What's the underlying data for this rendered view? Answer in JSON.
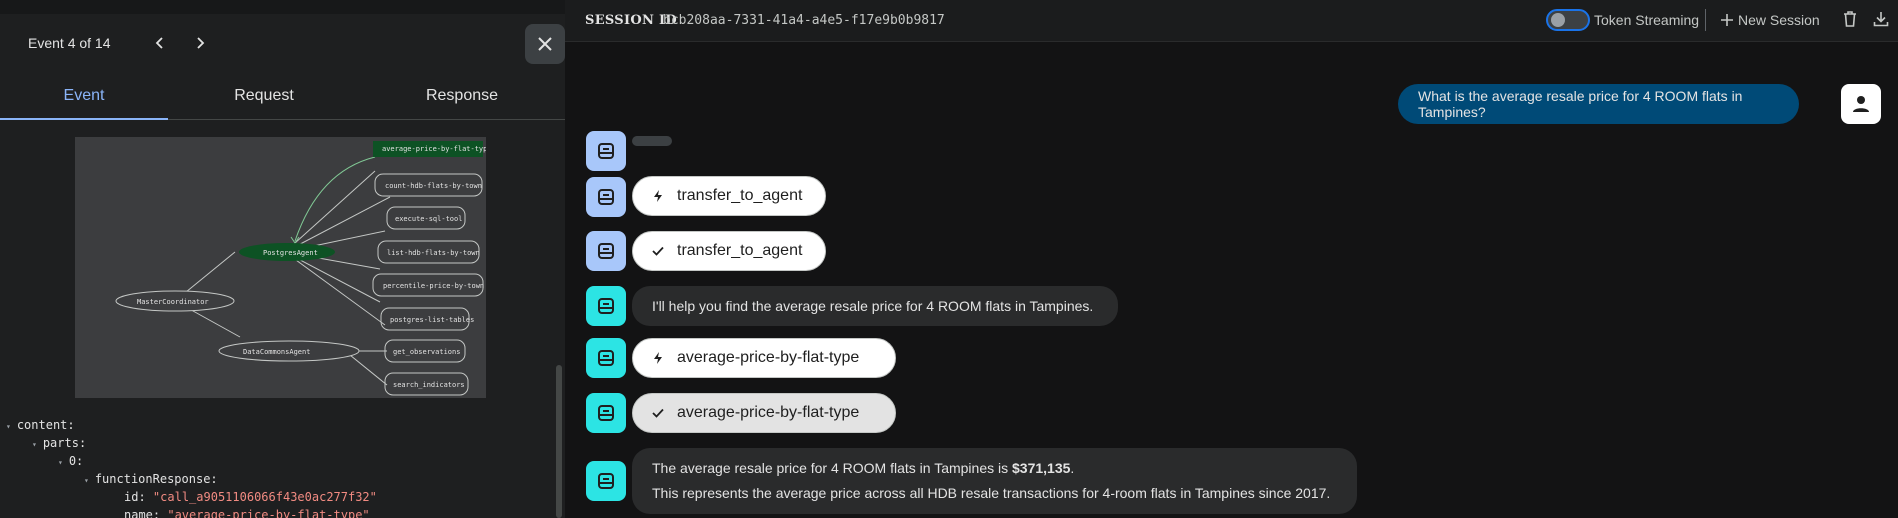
{
  "left": {
    "event_counter": "Event 4 of 14",
    "tabs": [
      {
        "label": "Event",
        "active": true
      },
      {
        "label": "Request",
        "active": false
      },
      {
        "label": "Response",
        "active": false
      }
    ],
    "graph": {
      "nodes": {
        "master": "MasterCoordinator",
        "postgres": "PostgresAgent",
        "datacommons": "DataCommonsAgent",
        "avg": "average-price-by-flat-type",
        "count": "count-hdb-flats-by-town",
        "exec": "execute-sql-tool",
        "list": "list-hdb-flats-by-town",
        "percentile": "percentile-price-by-town",
        "pglist": "postgres-list-tables",
        "obs": "get_observations",
        "search": "search_indicators"
      }
    },
    "json_tree": {
      "content": "content:",
      "parts": "parts:",
      "index0": "0:",
      "functionResponse": "functionResponse:",
      "id_key": "id:",
      "id_val": "\"call_a9051106066f43e0ac277f32\"",
      "name_key": "name:",
      "name_val": "\"average-price-by-flat-type\""
    }
  },
  "header": {
    "session_label": "SESSION ID",
    "session_id": "bcb208aa-7331-41a4-a4e5-f17e9b0b9817",
    "token_streaming": "Token Streaming",
    "new_session": "New Session"
  },
  "chat": {
    "user_message": "What is the average resale price for 4 ROOM flats in Tampines?",
    "call1": "transfer_to_agent",
    "result1": "transfer_to_agent",
    "bot_text1": "I'll help you find the average resale price for 4 ROOM flats in Tampines.",
    "call2": "average-price-by-flat-type",
    "result2": "average-price-by-flat-type",
    "final_line1_pre": "The average resale price for 4 ROOM flats in Tampines is ",
    "final_line1_bold": "$371,135",
    "final_line1_post": ".",
    "final_line2": "This represents the average price across all HDB resale transactions for 4-room flats in Tampines since 2017."
  },
  "colors": {
    "accent": "#8ab4f8",
    "user_bubble": "#004a77",
    "agent_avatar_blue": "#a8c7fa",
    "agent_avatar_cyan": "#2ce4e4",
    "graph_highlight": "#0d5224"
  }
}
